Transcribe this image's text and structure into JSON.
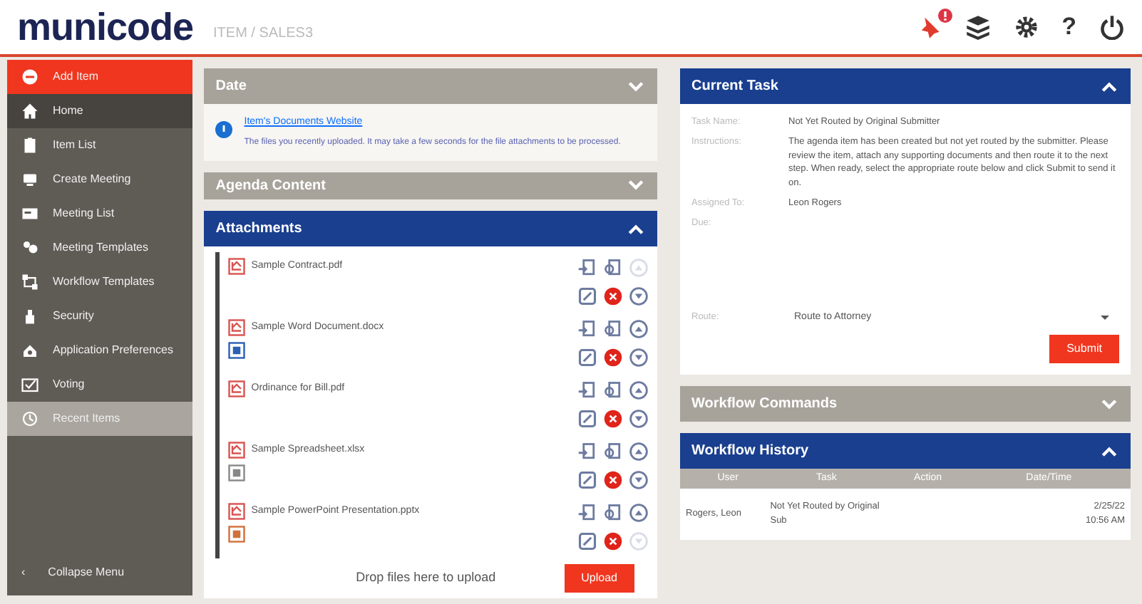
{
  "header": {
    "logo": "municode",
    "breadcrumb": "ITEM / SALES3",
    "help": "?"
  },
  "sidebar": {
    "items": [
      {
        "label": "Add Item",
        "kind": "add",
        "selected": false,
        "highlighted": false
      },
      {
        "label": "Home",
        "kind": "home",
        "selected": true,
        "highlighted": false
      },
      {
        "label": "Item List",
        "kind": "list",
        "selected": false,
        "highlighted": false
      },
      {
        "label": "Create Meeting",
        "kind": "create",
        "selected": false,
        "highlighted": false
      },
      {
        "label": "Meeting List",
        "kind": "meetings",
        "selected": false,
        "highlighted": false
      },
      {
        "label": "Meeting Templates",
        "kind": "templates",
        "selected": false,
        "highlighted": false
      },
      {
        "label": "Workflow Templates",
        "kind": "workflow",
        "selected": false,
        "highlighted": false
      },
      {
        "label": "Security",
        "kind": "security",
        "selected": false,
        "highlighted": false
      },
      {
        "label": "Application Preferences",
        "kind": "preferences",
        "selected": false,
        "highlighted": false
      },
      {
        "label": "Voting",
        "kind": "voting",
        "selected": false,
        "highlighted": false
      },
      {
        "label": "Recent Items",
        "kind": "recent",
        "selected": false,
        "highlighted": true
      }
    ],
    "collapse": {
      "arrow": "‹",
      "label": "Collapse Menu"
    }
  },
  "date_panel": {
    "title": "Date",
    "expanded": false,
    "link": "Item's Documents Website",
    "note": "The files you recently uploaded. It may take a few seconds for the file attachments to be processed."
  },
  "agenda_panel": {
    "title": "Agenda Content",
    "expanded": false
  },
  "attachments_panel": {
    "title": "Attachments",
    "expanded": true,
    "files": [
      {
        "name": "Sample Contract.pdf",
        "kind": "plain",
        "up_disabled": true,
        "down_disabled": false
      },
      {
        "name": "Sample Word Document.docx",
        "kind": "word",
        "up_disabled": false,
        "down_disabled": false
      },
      {
        "name": "Ordinance for Bill.pdf",
        "kind": "plain",
        "up_disabled": false,
        "down_disabled": false
      },
      {
        "name": "Sample Spreadsheet.xlsx",
        "kind": "excel",
        "up_disabled": false,
        "down_disabled": false
      },
      {
        "name": "Sample PowerPoint Presentation.pptx",
        "kind": "powerpoint",
        "up_disabled": false,
        "down_disabled": true
      }
    ],
    "drop_hint": "Drop files here to upload",
    "upload": "Upload"
  },
  "current_task": {
    "title": "Current Task",
    "expanded": true,
    "fields": [
      {
        "label": "Task Name:",
        "value": "Not Yet Routed by Original Submitter"
      },
      {
        "label": "Instructions:",
        "value": "The agenda item has been created but not yet routed by the submitter. Please review the item, attach any supporting documents and then route it to the next step. When ready, select the appropriate route below and click Submit to send it on."
      },
      {
        "label": "Assigned To:",
        "value": "Leon Rogers"
      },
      {
        "label": "Due:"
      }
    ],
    "route_label": "Route:",
    "route": "Route to Attorney",
    "submit": "Submit"
  },
  "workflow_commands": {
    "title": "Workflow Commands",
    "expanded": false
  },
  "workflow_history": {
    "title": "Workflow History",
    "expanded": true,
    "columns": [
      "User",
      "Task",
      "Action",
      "Date/Time"
    ],
    "rows": [
      {
        "user": "Rogers, Leon",
        "task": "Not Yet Routed by Original Sub",
        "date": "2/25/22",
        "time": "10:56 AM"
      }
    ]
  }
}
